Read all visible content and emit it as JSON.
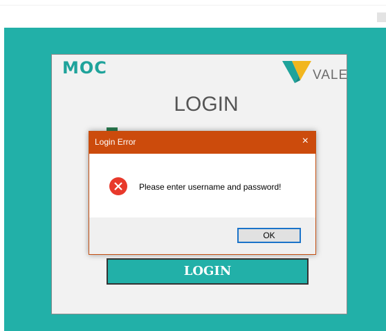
{
  "app": {
    "brand": "MOC",
    "logo_text": "VALE",
    "title": "LOGIN",
    "login_button": "LOGIN"
  },
  "dialog": {
    "title": "Login Error",
    "close_symbol": "×",
    "message": "Please enter username and password!",
    "ok_label": "OK",
    "icon": "error-icon"
  },
  "colors": {
    "background": "#22b0a8",
    "panel": "#f2f2f2",
    "dialog_title": "#cc4b0c",
    "error": "#e8392b",
    "ok_border": "#1a73c9"
  }
}
